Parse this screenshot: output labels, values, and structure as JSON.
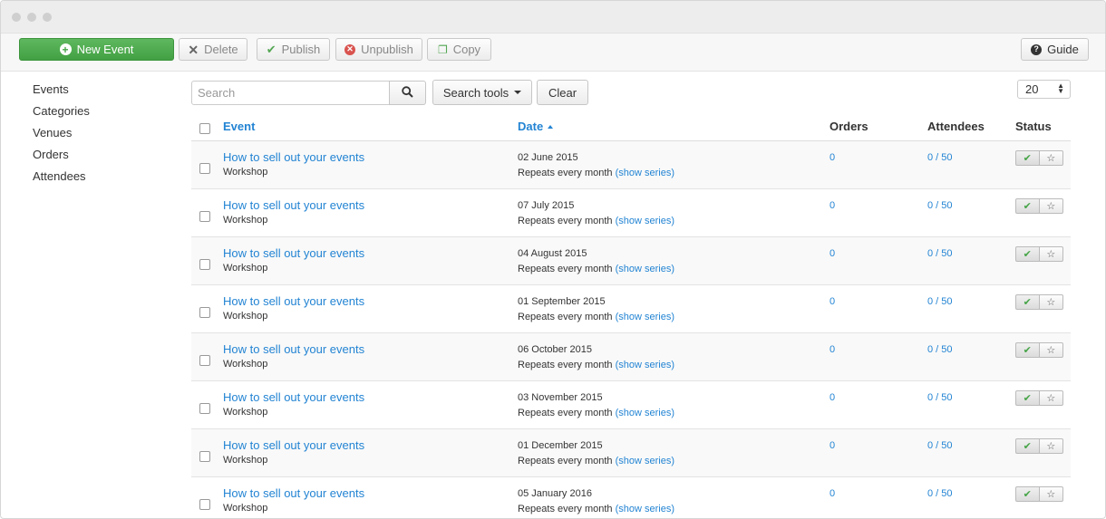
{
  "toolbar": {
    "new_label": "New Event",
    "delete_label": "Delete",
    "publish_label": "Publish",
    "unpublish_label": "Unpublish",
    "copy_label": "Copy",
    "guide_label": "Guide"
  },
  "sidebar": {
    "items": [
      {
        "label": "Events"
      },
      {
        "label": "Categories"
      },
      {
        "label": "Venues"
      },
      {
        "label": "Orders"
      },
      {
        "label": "Attendees"
      }
    ]
  },
  "filters": {
    "search_placeholder": "Search",
    "search_tools_label": "Search tools",
    "clear_label": "Clear",
    "list_limit": "20"
  },
  "table": {
    "headers": {
      "event": "Event",
      "date": "Date",
      "orders": "Orders",
      "attendees": "Attendees",
      "status": "Status"
    },
    "rows": [
      {
        "title": "How to sell out your events",
        "category": "Workshop",
        "date": "02 June 2015",
        "repeat": "Repeats every month",
        "series_link": "(show series)",
        "orders": "0",
        "attendees": "0 / 50"
      },
      {
        "title": "How to sell out your events",
        "category": "Workshop",
        "date": "07 July 2015",
        "repeat": "Repeats every month",
        "series_link": "(show series)",
        "orders": "0",
        "attendees": "0 / 50"
      },
      {
        "title": "How to sell out your events",
        "category": "Workshop",
        "date": "04 August 2015",
        "repeat": "Repeats every month",
        "series_link": "(show series)",
        "orders": "0",
        "attendees": "0 / 50"
      },
      {
        "title": "How to sell out your events",
        "category": "Workshop",
        "date": "01 September 2015",
        "repeat": "Repeats every month",
        "series_link": "(show series)",
        "orders": "0",
        "attendees": "0 / 50"
      },
      {
        "title": "How to sell out your events",
        "category": "Workshop",
        "date": "06 October 2015",
        "repeat": "Repeats every month",
        "series_link": "(show series)",
        "orders": "0",
        "attendees": "0 / 50"
      },
      {
        "title": "How to sell out your events",
        "category": "Workshop",
        "date": "03 November 2015",
        "repeat": "Repeats every month",
        "series_link": "(show series)",
        "orders": "0",
        "attendees": "0 / 50"
      },
      {
        "title": "How to sell out your events",
        "category": "Workshop",
        "date": "01 December 2015",
        "repeat": "Repeats every month",
        "series_link": "(show series)",
        "orders": "0",
        "attendees": "0 / 50"
      },
      {
        "title": "How to sell out your events",
        "category": "Workshop",
        "date": "05 January 2016",
        "repeat": "Repeats every month",
        "series_link": "(show series)",
        "orders": "0",
        "attendees": "0 / 50"
      }
    ]
  },
  "colors": {
    "link": "#2384d3",
    "success": "#46a447",
    "danger": "#d9534f"
  },
  "icons": {
    "new": "plus-circle-icon",
    "delete": "x-icon",
    "publish": "check-icon",
    "unpublish": "x-circle-icon",
    "copy": "copy-icon",
    "guide": "question-circle-icon",
    "search": "search-icon",
    "sort": "sort-asc-icon",
    "published": "check-icon",
    "featured": "star-icon"
  }
}
